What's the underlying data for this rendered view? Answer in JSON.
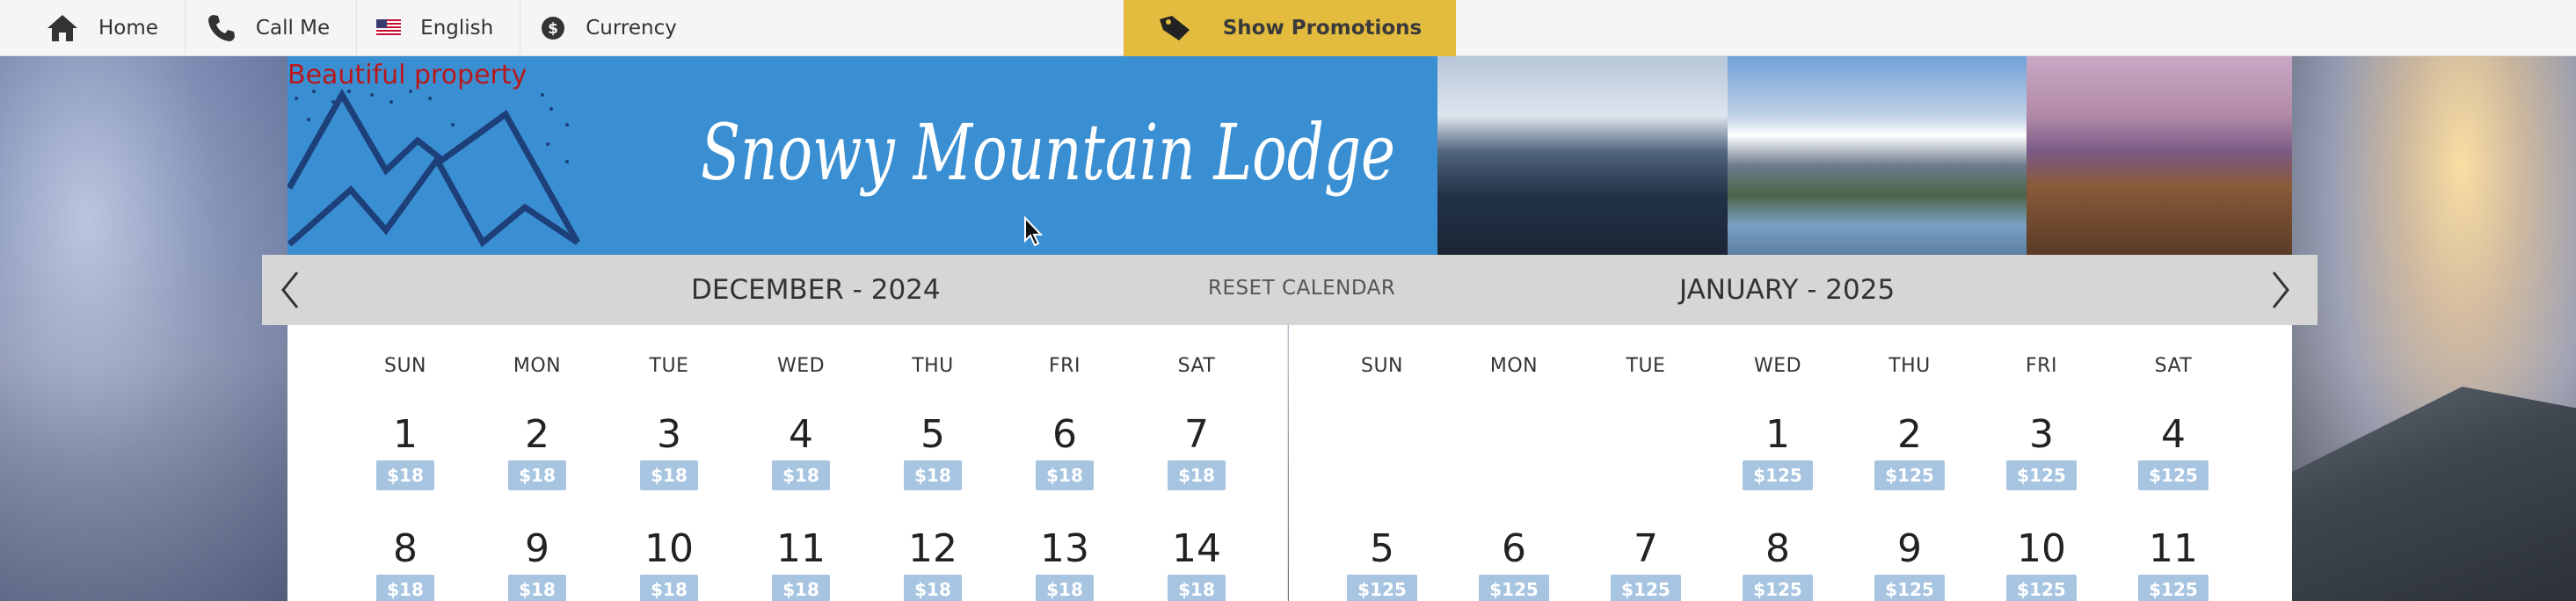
{
  "nav": {
    "home_label": "Home",
    "call_label": "Call Me",
    "language_label": "English",
    "currency_label": "Currency",
    "promo_label": "Show Promotions",
    "promo_color": "#e2bb3f"
  },
  "banner": {
    "property_label": "Beautiful property",
    "title": "Snowy Mountain Lodge",
    "background_color": "#3a8fd2"
  },
  "calendar": {
    "reset_label": "RESET CALENDAR",
    "price_badge_color": "#a7c4e1",
    "months": [
      {
        "title": "DECEMBER - 2024",
        "weekdays": [
          "SUN",
          "MON",
          "TUE",
          "WED",
          "THU",
          "FRI",
          "SAT"
        ],
        "weeks": [
          [
            {
              "day": "1",
              "price": "$18"
            },
            {
              "day": "2",
              "price": "$18"
            },
            {
              "day": "3",
              "price": "$18"
            },
            {
              "day": "4",
              "price": "$18"
            },
            {
              "day": "5",
              "price": "$18"
            },
            {
              "day": "6",
              "price": "$18"
            },
            {
              "day": "7",
              "price": "$18"
            }
          ],
          [
            {
              "day": "8",
              "price": "$18"
            },
            {
              "day": "9",
              "price": "$18"
            },
            {
              "day": "10",
              "price": "$18"
            },
            {
              "day": "11",
              "price": "$18"
            },
            {
              "day": "12",
              "price": "$18"
            },
            {
              "day": "13",
              "price": "$18"
            },
            {
              "day": "14",
              "price": "$18"
            }
          ]
        ]
      },
      {
        "title": "JANUARY - 2025",
        "weekdays": [
          "SUN",
          "MON",
          "TUE",
          "WED",
          "THU",
          "FRI",
          "SAT"
        ],
        "weeks": [
          [
            null,
            null,
            null,
            {
              "day": "1",
              "price": "$125"
            },
            {
              "day": "2",
              "price": "$125"
            },
            {
              "day": "3",
              "price": "$125"
            },
            {
              "day": "4",
              "price": "$125"
            }
          ],
          [
            {
              "day": "5",
              "price": "$125"
            },
            {
              "day": "6",
              "price": "$125"
            },
            {
              "day": "7",
              "price": "$125"
            },
            {
              "day": "8",
              "price": "$125"
            },
            {
              "day": "9",
              "price": "$125"
            },
            {
              "day": "10",
              "price": "$125"
            },
            {
              "day": "11",
              "price": "$125"
            }
          ]
        ]
      }
    ]
  }
}
